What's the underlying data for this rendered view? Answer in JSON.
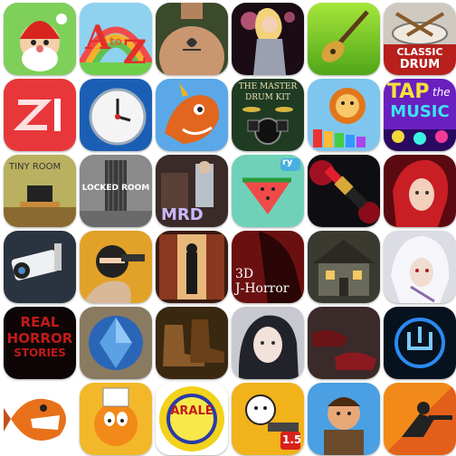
{
  "icons": [
    {
      "text": []
    },
    {
      "text": [
        "A",
        "to",
        "Z"
      ]
    },
    {
      "text": []
    },
    {
      "text": []
    },
    {
      "text": []
    },
    {
      "text": [
        "CLASSIC",
        "DRUM"
      ]
    },
    {
      "text": []
    },
    {
      "text": []
    },
    {
      "text": []
    },
    {
      "text": [
        "THE MASTER",
        "DRUM KIT"
      ]
    },
    {
      "text": []
    },
    {
      "text": [
        "TAP",
        "the",
        "MUSIC"
      ]
    },
    {
      "text": [
        "TINY ROOM"
      ]
    },
    {
      "text": [
        "LOCKED ROOM"
      ]
    },
    {
      "text": [
        "MRD"
      ]
    },
    {
      "text": [
        "ry"
      ]
    },
    {
      "text": []
    },
    {
      "text": []
    },
    {
      "text": []
    },
    {
      "text": []
    },
    {
      "text": []
    },
    {
      "text": [
        "3D",
        "J-Horror"
      ]
    },
    {
      "text": []
    },
    {
      "text": []
    },
    {
      "text": [
        "REAL",
        "HORROR",
        "STORIES"
      ]
    },
    {
      "text": []
    },
    {
      "text": []
    },
    {
      "text": []
    },
    {
      "text": []
    },
    {
      "text": []
    },
    {
      "text": []
    },
    {
      "text": []
    },
    {
      "text": [
        "ARALE"
      ]
    },
    {
      "text": [
        "1.5"
      ]
    },
    {
      "text": []
    },
    {
      "text": []
    }
  ]
}
